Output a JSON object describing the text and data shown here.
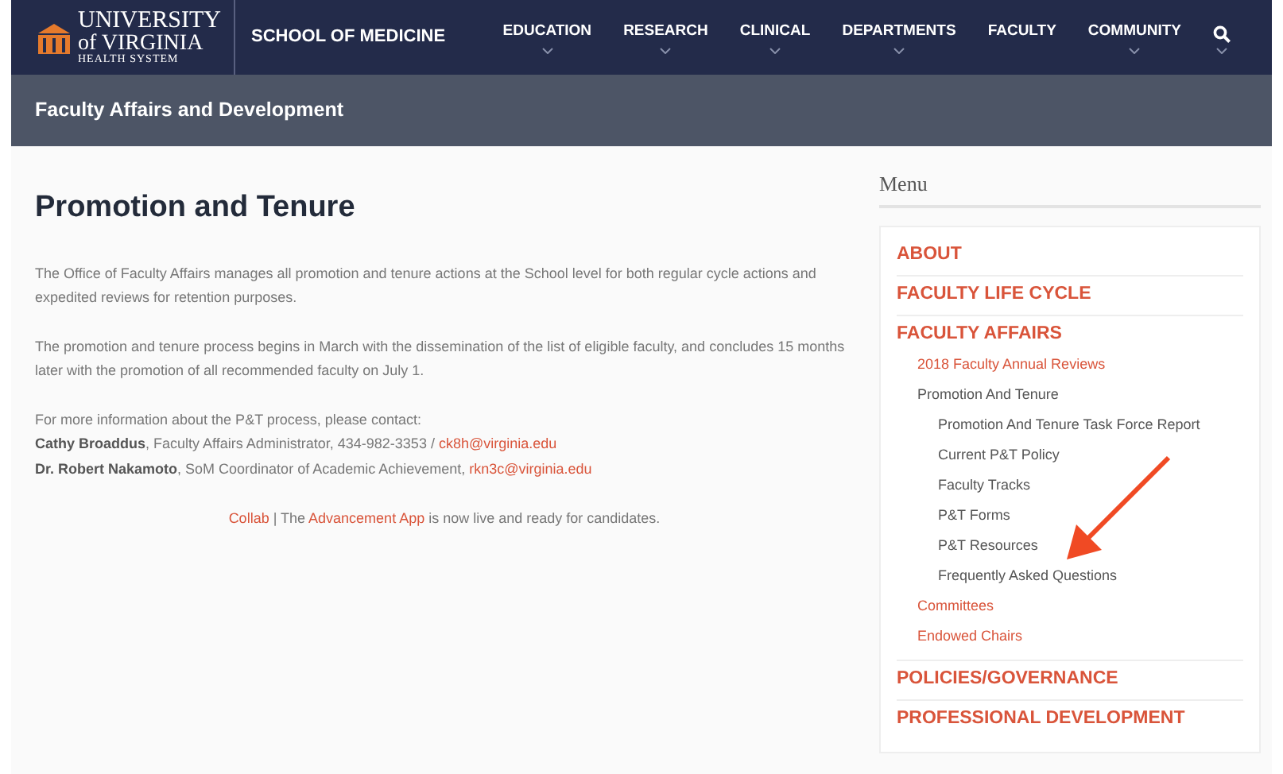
{
  "header": {
    "logo_lines": [
      "UNIVERSITY",
      "of VIRGINIA",
      "HEALTH SYSTEM"
    ],
    "site_title": "SCHOOL OF MEDICINE",
    "nav": [
      {
        "label": "EDUCATION",
        "has_dropdown": true
      },
      {
        "label": "RESEARCH",
        "has_dropdown": true
      },
      {
        "label": "CLINICAL",
        "has_dropdown": true
      },
      {
        "label": "DEPARTMENTS",
        "has_dropdown": true
      },
      {
        "label": "FACULTY",
        "has_dropdown": false
      },
      {
        "label": "COMMUNITY",
        "has_dropdown": true
      }
    ]
  },
  "section_bar": {
    "title": "Faculty Affairs and Development"
  },
  "main": {
    "heading": "Promotion and Tenure",
    "paragraphs": [
      "The Office of Faculty Affairs manages all promotion and tenure actions at the School level for both regular cycle actions and expedited reviews for retention purposes.",
      "The promotion and tenure process begins in March with the dissemination of the list of eligible faculty, and concludes 15 months later with the promotion of all recommended faculty on July 1."
    ],
    "contact_intro": "For more information about the P&T process, please contact:",
    "contacts": [
      {
        "text": "**Cathy Broaddus**, Faculty Affairs Administrator, 434-982-3353 / ",
        "email": "ck8h@virginia.edu"
      },
      {
        "text": "**Dr. Robert Nakamoto**, SoM Coordinator of Academic Achievement, ",
        "email": "rkn3c@virginia.edu"
      }
    ],
    "notice": [
      {
        "kind": "link",
        "text": "Collab"
      },
      {
        "kind": "text",
        "text": " | The "
      },
      {
        "kind": "link",
        "text": "Advancement App"
      },
      {
        "kind": "text",
        "text": " is now live and ready for candidates."
      }
    ]
  },
  "sidebar": {
    "title": "Menu",
    "items": [
      {
        "label": "ABOUT",
        "selected": false
      },
      {
        "label": "FACULTY LIFE CYCLE",
        "selected": false
      },
      {
        "label": "FACULTY AFFAIRS",
        "selected": false,
        "children": [
          {
            "label": "2018 Faculty Annual Reviews",
            "selected": false
          },
          {
            "label": "Promotion And Tenure",
            "selected": true,
            "children": [
              {
                "label": "Promotion And Tenure Task Force Report",
                "selected": false
              },
              {
                "label": "Current P&T Policy",
                "selected": false
              },
              {
                "label": "Faculty Tracks",
                "selected": false
              },
              {
                "label": "P&T Forms",
                "selected": false
              },
              {
                "label": "P&T Resources",
                "selected": false
              },
              {
                "label": "Frequently Asked Questions",
                "selected": false
              }
            ]
          },
          {
            "label": "Committees",
            "selected": false
          },
          {
            "label": "Endowed Chairs",
            "selected": false
          }
        ]
      },
      {
        "label": "POLICIES/GOVERNANCE",
        "selected": false
      },
      {
        "label": "PROFESSIONAL DEVELOPMENT",
        "selected": false
      }
    ]
  }
}
